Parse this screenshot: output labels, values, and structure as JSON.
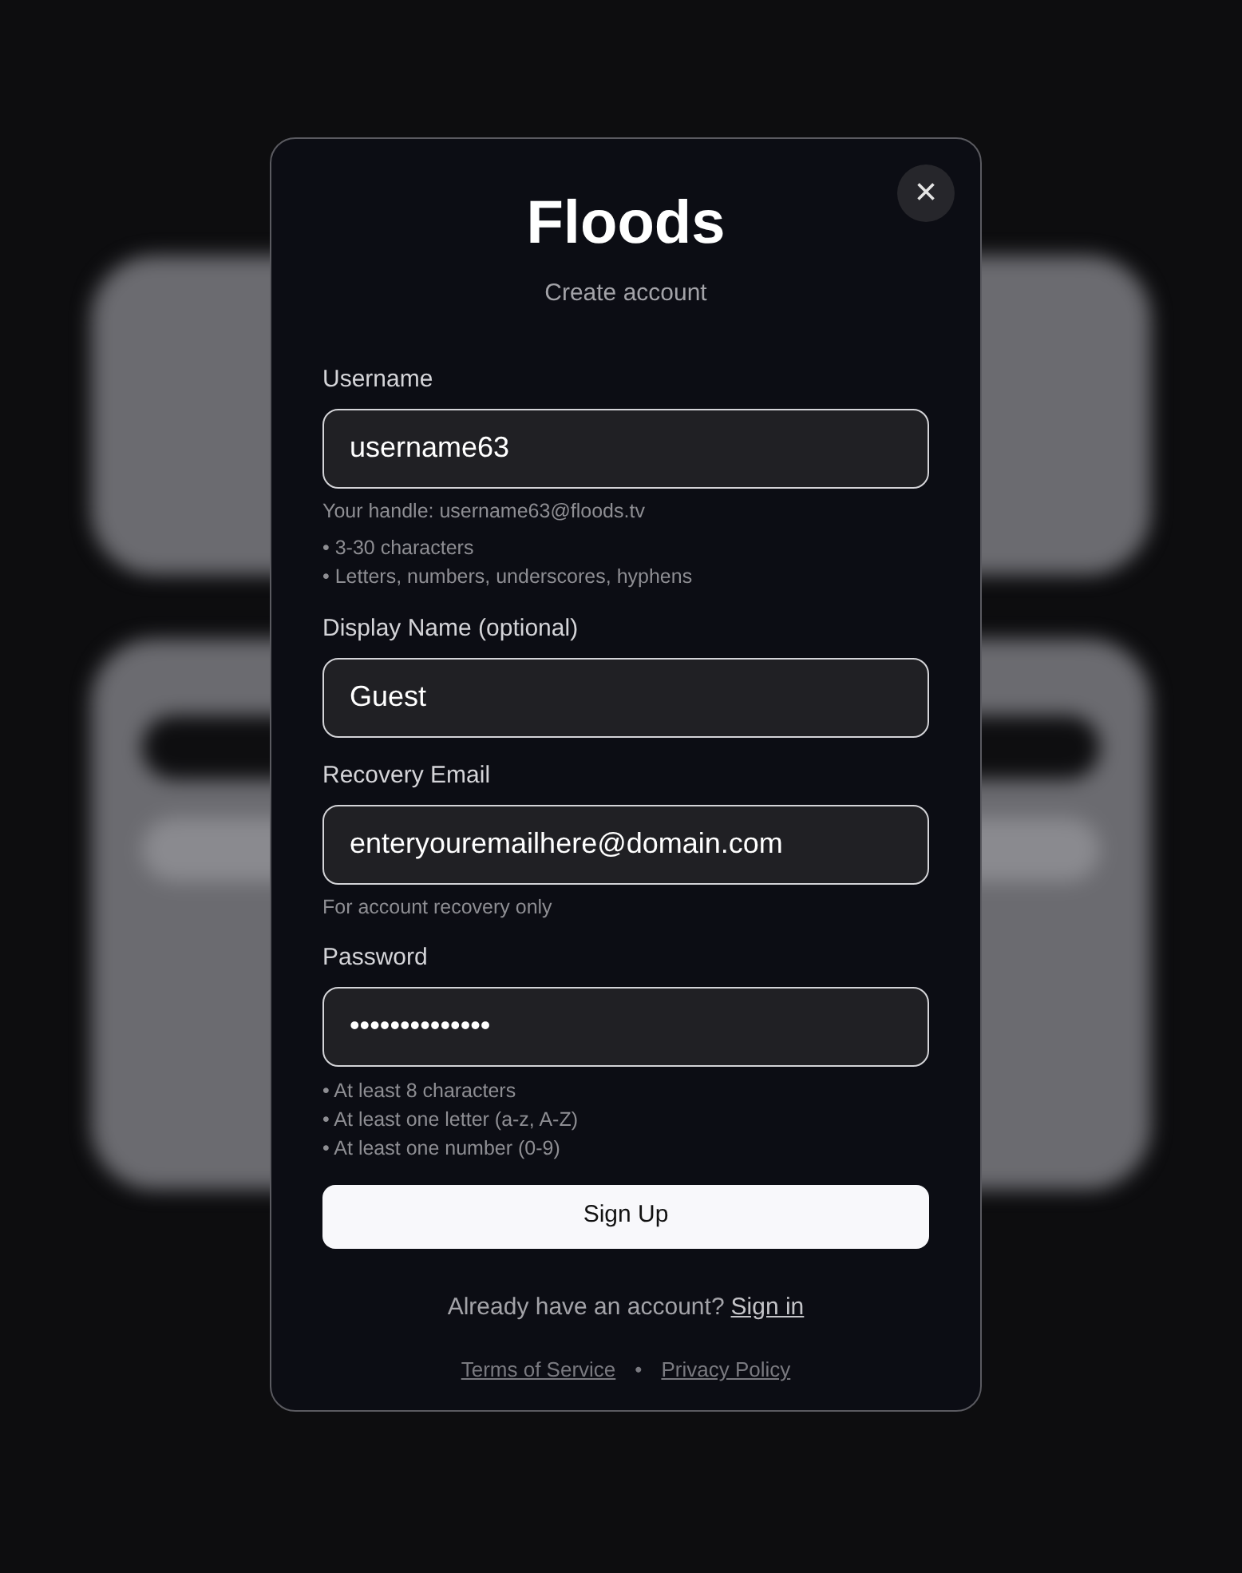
{
  "dialog": {
    "title": "Floods",
    "subtitle": "Create account",
    "close": "×",
    "fields": [
      {
        "label": "Username",
        "value": "username63",
        "hints": [
          "Your handle: username63@floods.tv"
        ],
        "rules": [
          "• 3-30 characters",
          "• Letters, numbers, underscores, hyphens"
        ]
      },
      {
        "label": "Display Name (optional)",
        "value": "Guest"
      },
      {
        "label": "Recovery Email",
        "value": "enteryouremailhere@domain.com",
        "hints": [
          "For account recovery only"
        ]
      },
      {
        "label": "Password",
        "value": "••••••••••••••",
        "rules": [
          "• At least 8 characters",
          "• At least one letter (a-z, A-Z)",
          "• At least one number (0-9)"
        ]
      }
    ],
    "submit": "Sign Up",
    "signin_prompt": "Already have an account?",
    "signin_link": "Sign in",
    "links": [
      "Terms of Service",
      "Privacy Policy"
    ],
    "link_separator": "•"
  }
}
